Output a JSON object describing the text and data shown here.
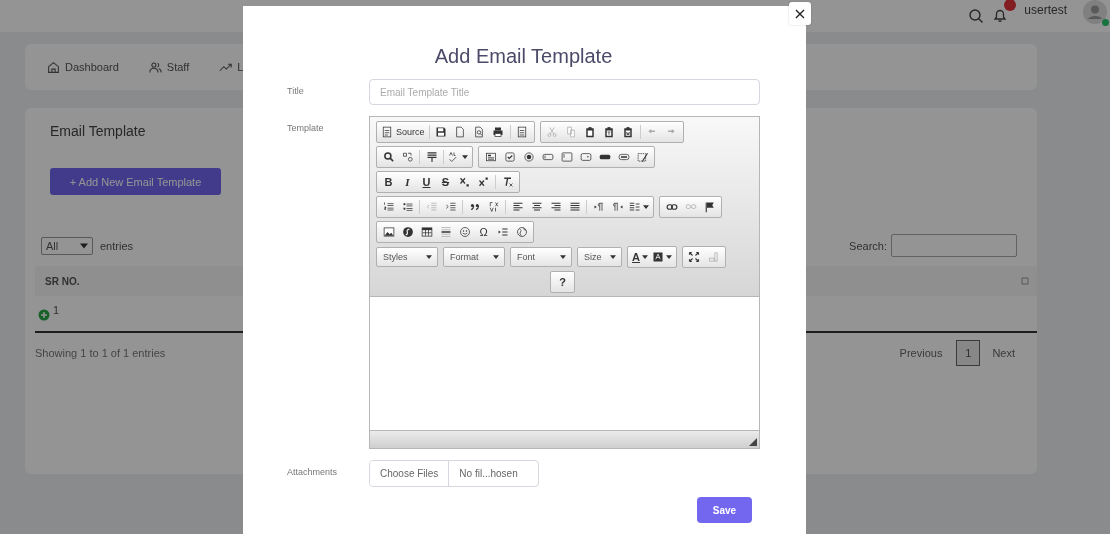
{
  "header": {
    "username": "usertest",
    "online": true
  },
  "nav": [
    {
      "label": "Dashboard"
    },
    {
      "label": "Staff"
    },
    {
      "label": "L"
    }
  ],
  "page": {
    "title": "Email Template",
    "add_button": "+ Add New Email Template",
    "length_select": "All",
    "entries_label": "entries",
    "search_label": "Search:",
    "table": {
      "columns": [
        "SR NO."
      ],
      "rows": [
        [
          "1"
        ]
      ]
    },
    "info": "Showing 1 to 1 of 1 entries",
    "pagination": {
      "previous": "Previous",
      "pages": [
        {
          "label": "1",
          "selected": true
        }
      ],
      "next": "Next"
    }
  },
  "modal": {
    "close": "×",
    "title": "Add Email Template",
    "title_field": {
      "label": "Title",
      "placeholder": "Email Template Title"
    },
    "template_field": {
      "label": "Template",
      "toolbar_texts": [
        {
          "text": "Source",
          "kind": "plain"
        },
        {
          "text": "B",
          "kind": "bold"
        },
        {
          "text": "I",
          "kind": "italic"
        },
        {
          "text": "U",
          "kind": "underline"
        },
        {
          "text": "S",
          "kind": "strike"
        },
        {
          "text": "Ω",
          "kind": "plain"
        },
        {
          "text": "A",
          "kind": "underline"
        },
        {
          "text": "?",
          "kind": "bold"
        }
      ],
      "combos": [
        "Styles",
        "Format",
        "Font",
        "Size"
      ]
    },
    "attachments": {
      "label": "Attachments",
      "button": "Choose Files",
      "status": "No fil...hosen"
    },
    "save": "Save"
  }
}
